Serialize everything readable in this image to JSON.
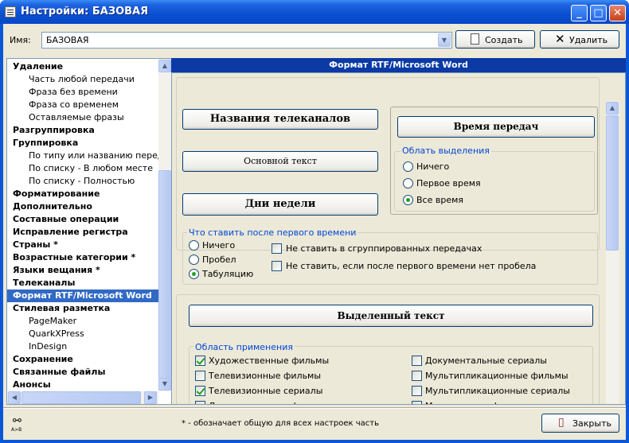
{
  "window": {
    "title": "Настройки: БАЗОВАЯ"
  },
  "name_row": {
    "label": "Имя:",
    "value": "БАЗОВАЯ",
    "create_label": "Создать",
    "delete_label": "Удалить"
  },
  "tree": {
    "items": [
      {
        "label": "Удаление",
        "level": 0
      },
      {
        "label": "Часть любой передачи",
        "level": 1
      },
      {
        "label": "Фраза без времени",
        "level": 1
      },
      {
        "label": "Фраза со временем",
        "level": 1
      },
      {
        "label": "Оставляемые фразы",
        "level": 1
      },
      {
        "label": "Разгруппировка",
        "level": 0
      },
      {
        "label": "Группировка",
        "level": 0
      },
      {
        "label": "По типу или названию передачи",
        "level": 1
      },
      {
        "label": "По списку - В любом месте",
        "level": 1
      },
      {
        "label": "По списку - Полностью",
        "level": 1
      },
      {
        "label": "Форматирование",
        "level": 0
      },
      {
        "label": "Дополнительно",
        "level": 0
      },
      {
        "label": "Составные операции",
        "level": 0
      },
      {
        "label": "Исправление регистра",
        "level": 0
      },
      {
        "label": "Страны *",
        "level": 0
      },
      {
        "label": "Возрастные категории *",
        "level": 0
      },
      {
        "label": "Языки вещания *",
        "level": 0
      },
      {
        "label": "Телеканалы",
        "level": 0
      },
      {
        "label": "Формат RTF/Microsoft Word",
        "level": 0,
        "selected": true
      },
      {
        "label": "Стилевая разметка",
        "level": 0
      },
      {
        "label": "PageMaker",
        "level": 1
      },
      {
        "label": "QuarkXPress",
        "level": 1
      },
      {
        "label": "InDesign",
        "level": 1
      },
      {
        "label": "Сохранение",
        "level": 0
      },
      {
        "label": "Связанные файлы",
        "level": 0
      },
      {
        "label": "Анонсы",
        "level": 0
      }
    ]
  },
  "panel": {
    "header": "Формат RTF/Microsoft Word",
    "buttons": {
      "channel_names": "Названия телеканалов",
      "main_text": "Основной текст",
      "weekdays": "Дни недели",
      "broadcast_time": "Время передач",
      "selected_text": "Выделенный текст"
    },
    "selection_area": {
      "title": "Облать выделения",
      "options": [
        "Ничего",
        "Первое время",
        "Все время"
      ],
      "selected": 2
    },
    "after_first_time": {
      "title": "Что ставить после первого времени",
      "options": [
        "Ничего",
        "Пробел",
        "Табуляцию"
      ],
      "selected": 2,
      "checks": [
        {
          "label": "Не ставить в сгруппированных передачах",
          "checked": false
        },
        {
          "label": "Не ставить, если после первого времени нет пробела",
          "checked": false
        }
      ]
    },
    "scope": {
      "title": "Область применения",
      "left": [
        {
          "label": "Художественные фильмы",
          "checked": true
        },
        {
          "label": "Телевизионные фильмы",
          "checked": false
        },
        {
          "label": "Телевизионные сериалы",
          "checked": true
        },
        {
          "label": "Документальные фильмы",
          "checked": false
        }
      ],
      "right": [
        {
          "label": "Документальные сериалы",
          "checked": false
        },
        {
          "label": "Мультипликационные фильмы",
          "checked": false
        },
        {
          "label": "Мультипликационные сериалы",
          "checked": false
        },
        {
          "label": "Музыкальные фильмы",
          "checked": false
        }
      ]
    }
  },
  "footer": {
    "note": "* - обозначает общую для всех настроек часть",
    "close_label": "Закрыть",
    "binoculars_caption": "A>B"
  }
}
